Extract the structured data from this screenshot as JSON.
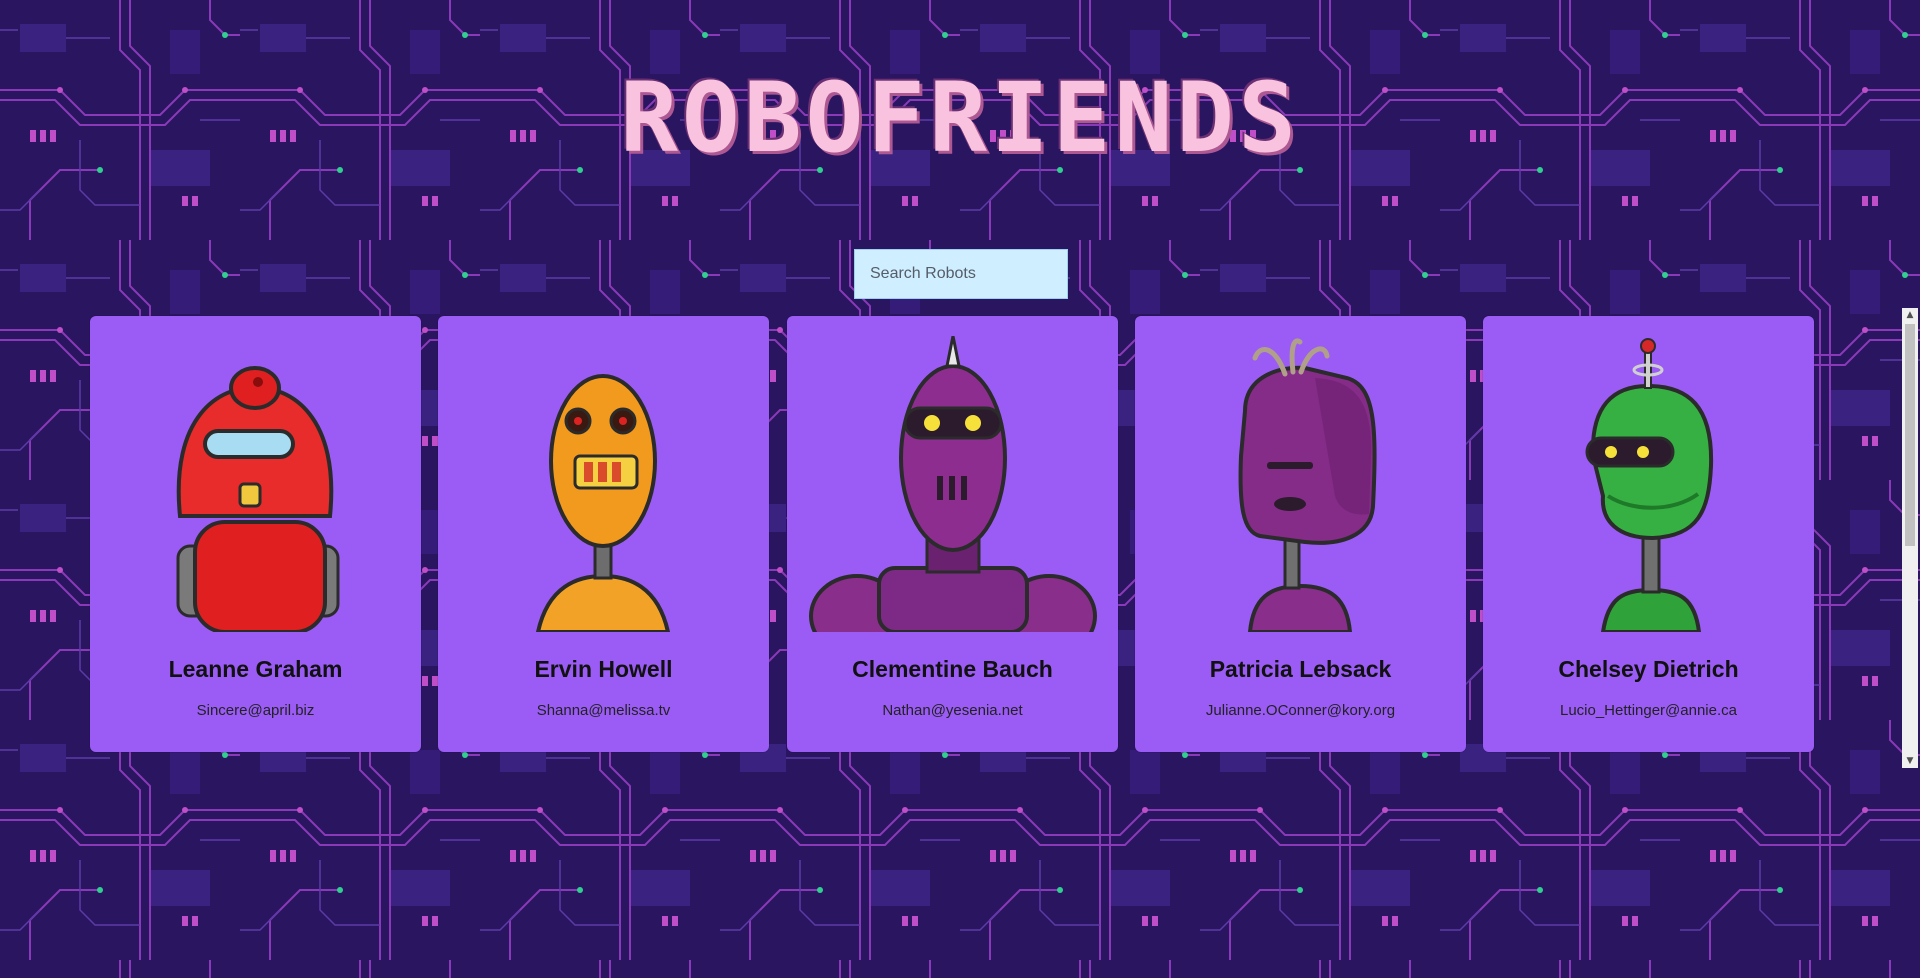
{
  "app": {
    "title": "ROBOFRIENDS"
  },
  "search": {
    "placeholder": "Search Robots",
    "value": ""
  },
  "robots": [
    {
      "name": "Leanne Graham",
      "email": "Sincere@april.biz",
      "avatar": "red-robot-icon"
    },
    {
      "name": "Ervin Howell",
      "email": "Shanna@melissa.tv",
      "avatar": "orange-robot-icon"
    },
    {
      "name": "Clementine Bauch",
      "email": "Nathan@yesenia.net",
      "avatar": "purple-robot-icon"
    },
    {
      "name": "Patricia Lebsack",
      "email": "Julianne.OConner@kory.org",
      "avatar": "violet-robot-icon"
    },
    {
      "name": "Chelsey Dietrich",
      "email": "Lucio_Hettinger@annie.ca",
      "avatar": "green-robot-icon"
    }
  ],
  "colors": {
    "background": "#2a1560",
    "circuit": "#9b3fc4",
    "title": "#f9c3df",
    "card": "#9b5cf5",
    "search_bg": "#cfeeff"
  }
}
